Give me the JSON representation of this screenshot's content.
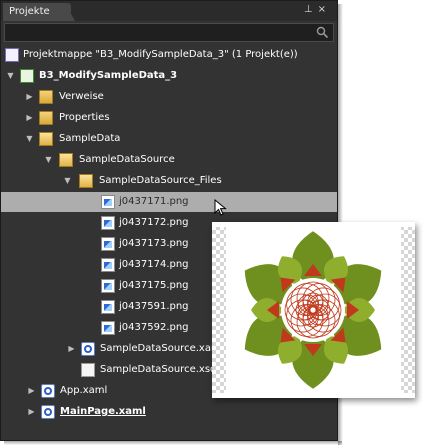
{
  "panel": {
    "title": "Projekte",
    "pin_glyph": "⊥",
    "close_glyph": "×",
    "search_placeholder": ""
  },
  "tree": {
    "solution": "Projektmappe \"B3_ModifySampleData_3\" (1 Projekt(e))",
    "project": "B3_ModifySampleData_3",
    "items": [
      {
        "label": "Verweise"
      },
      {
        "label": "Properties"
      },
      {
        "label": "SampleData"
      },
      {
        "label": "SampleDataSource"
      },
      {
        "label": "SampleDataSource_Files"
      },
      {
        "label": "j0437171.png"
      },
      {
        "label": "j0437172.png"
      },
      {
        "label": "j0437173.png"
      },
      {
        "label": "j0437174.png"
      },
      {
        "label": "j0437175.png"
      },
      {
        "label": "j0437591.png"
      },
      {
        "label": "j0437592.png"
      },
      {
        "label": "SampleDataSource.xaml"
      },
      {
        "label": "SampleDataSource.xsd"
      },
      {
        "label": "App.xaml"
      },
      {
        "label": "MainPage.xaml"
      }
    ],
    "selected": "j0437171.png"
  },
  "colors": {
    "panel_bg": "#333333",
    "selection_bg": "#adadad",
    "leaf_green": "#6f8f1e",
    "petal_red": "#c0391c"
  },
  "icons": [
    "search-icon",
    "pin-icon",
    "close-icon",
    "solution-icon",
    "project-icon",
    "folder-icon",
    "image-file-icon",
    "xaml-file-icon",
    "document-icon",
    "mouse-cursor-icon"
  ]
}
